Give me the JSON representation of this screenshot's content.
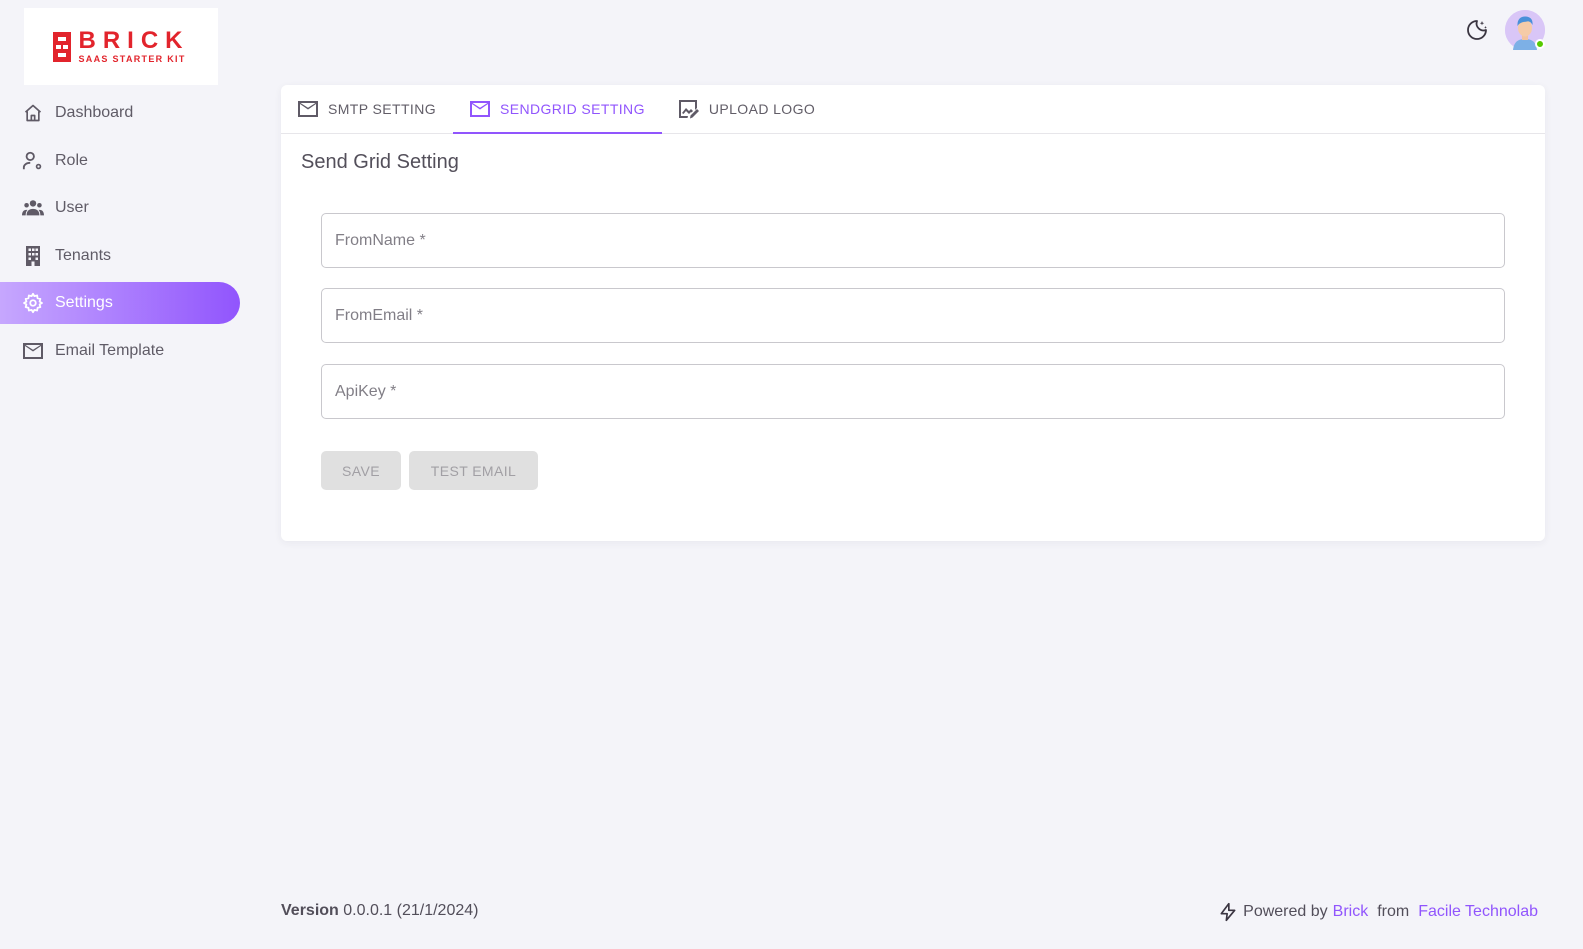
{
  "brand": {
    "title": "BRICK",
    "subtitle": "SAAS STARTER KIT",
    "color": "#e2242c"
  },
  "sidebar": {
    "items": [
      {
        "label": "Dashboard",
        "icon": "home-icon"
      },
      {
        "label": "Role",
        "icon": "user-cog-icon"
      },
      {
        "label": "User",
        "icon": "users-icon"
      },
      {
        "label": "Tenants",
        "icon": "building-icon"
      },
      {
        "label": "Settings",
        "icon": "gear-icon",
        "active": true
      },
      {
        "label": "Email Template",
        "icon": "mail-icon"
      }
    ]
  },
  "header": {
    "theme_toggle_icon": "moon-stars-icon",
    "avatar_status": "online"
  },
  "tabs": [
    {
      "label": "SMTP SETTING",
      "icon": "mail-icon"
    },
    {
      "label": "SENDGRID SETTING",
      "icon": "mail-icon",
      "active": true
    },
    {
      "label": "UPLOAD LOGO",
      "icon": "image-edit-icon"
    }
  ],
  "form": {
    "title": "Send Grid Setting",
    "fields": {
      "from_name": {
        "placeholder": "FromName *",
        "value": ""
      },
      "from_email": {
        "placeholder": "FromEmail *",
        "value": ""
      },
      "api_key": {
        "placeholder": "ApiKey *",
        "value": ""
      }
    },
    "save_label": "SAVE",
    "test_email_label": "TEST EMAIL"
  },
  "footer": {
    "version_label": "Version",
    "version_value": "0.0.0.1 (21/1/2024)",
    "powered_by": "Powered by",
    "brand_link": "Brick",
    "from": "from",
    "company_link": "Facile Technolab"
  },
  "colors": {
    "accent": "#9155fd",
    "background": "#f4f4f9",
    "online": "#56ca00"
  }
}
